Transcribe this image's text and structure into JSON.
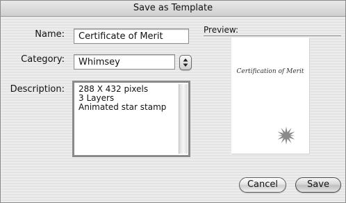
{
  "window": {
    "title": "Save as Template"
  },
  "form": {
    "name_label": "Name:",
    "name_value": "Certificate of Merit",
    "category_label": "Category:",
    "category_value": "Whimsey",
    "description_label": "Description:",
    "description_lines": [
      "288 X 432 pixels",
      "3 Layers",
      "Animated star stamp"
    ]
  },
  "preview": {
    "title": "Preview:",
    "caption": "Certification of Merit",
    "stamp_icon": "star-burst-icon"
  },
  "buttons": {
    "cancel": "Cancel",
    "save": "Save"
  },
  "icons": {
    "stepper": "stepper-arrows-icon"
  }
}
